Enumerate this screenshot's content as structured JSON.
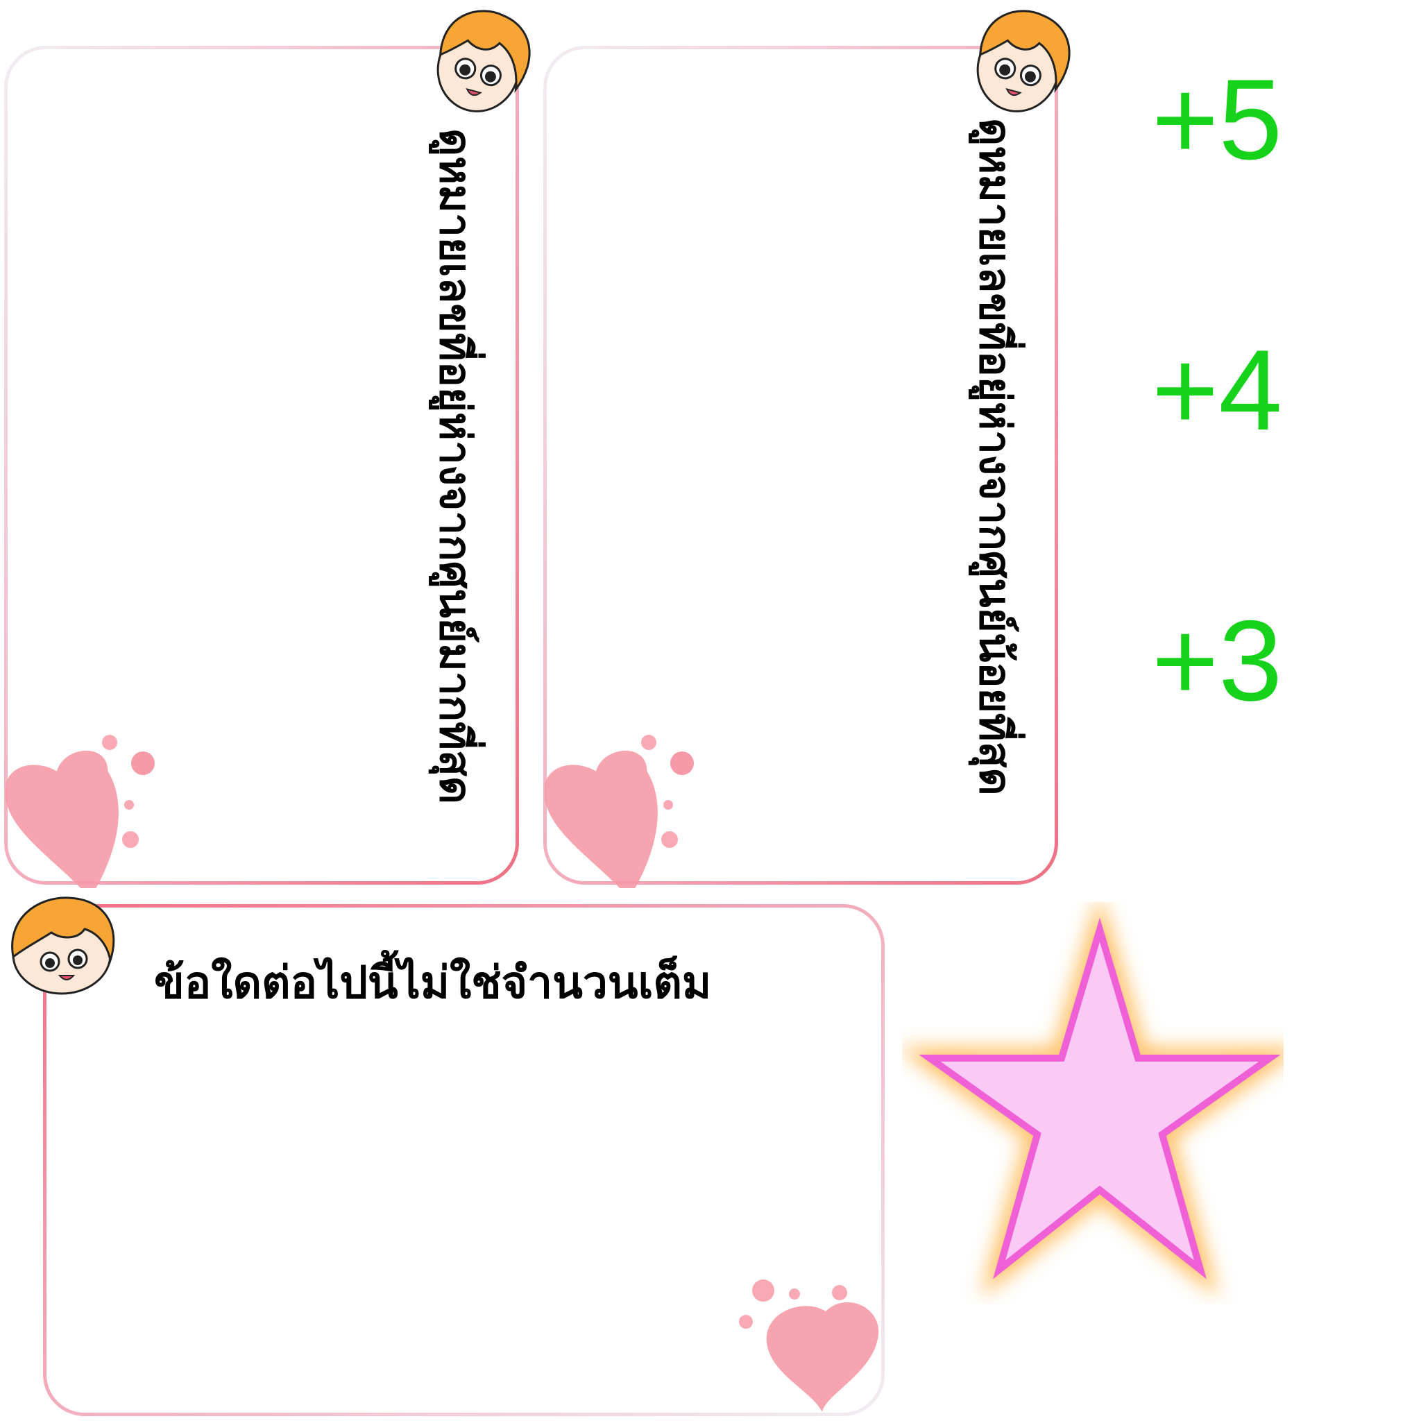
{
  "cards": {
    "left": {
      "vertical_text": "ดูหมายเลขที่อยู่ห่างจากศูนย์มากที่สุด"
    },
    "middle": {
      "vertical_text": "ดูหมายเลขที่อยู่ห่างจากศูนย์น้อยที่สุด"
    },
    "bottom": {
      "title": "ข้อใดต่อไปนี้ไม่ใช่จำนวนเต็ม"
    }
  },
  "scores": [
    "+5",
    "+4",
    "+3"
  ],
  "icons": {
    "character": "cartoon-boy-face-icon",
    "heart": "pink-heart-icon",
    "star": "pink-star-icon"
  },
  "colors": {
    "score_green": "#16d21b",
    "border_pink": "#ee6f84",
    "star_fill": "#fbc9f5",
    "star_stroke": "#ef5fd5",
    "star_glow": "#ffb347",
    "hair_orange": "#f7a534",
    "heart_pink": "#f59aa6"
  }
}
